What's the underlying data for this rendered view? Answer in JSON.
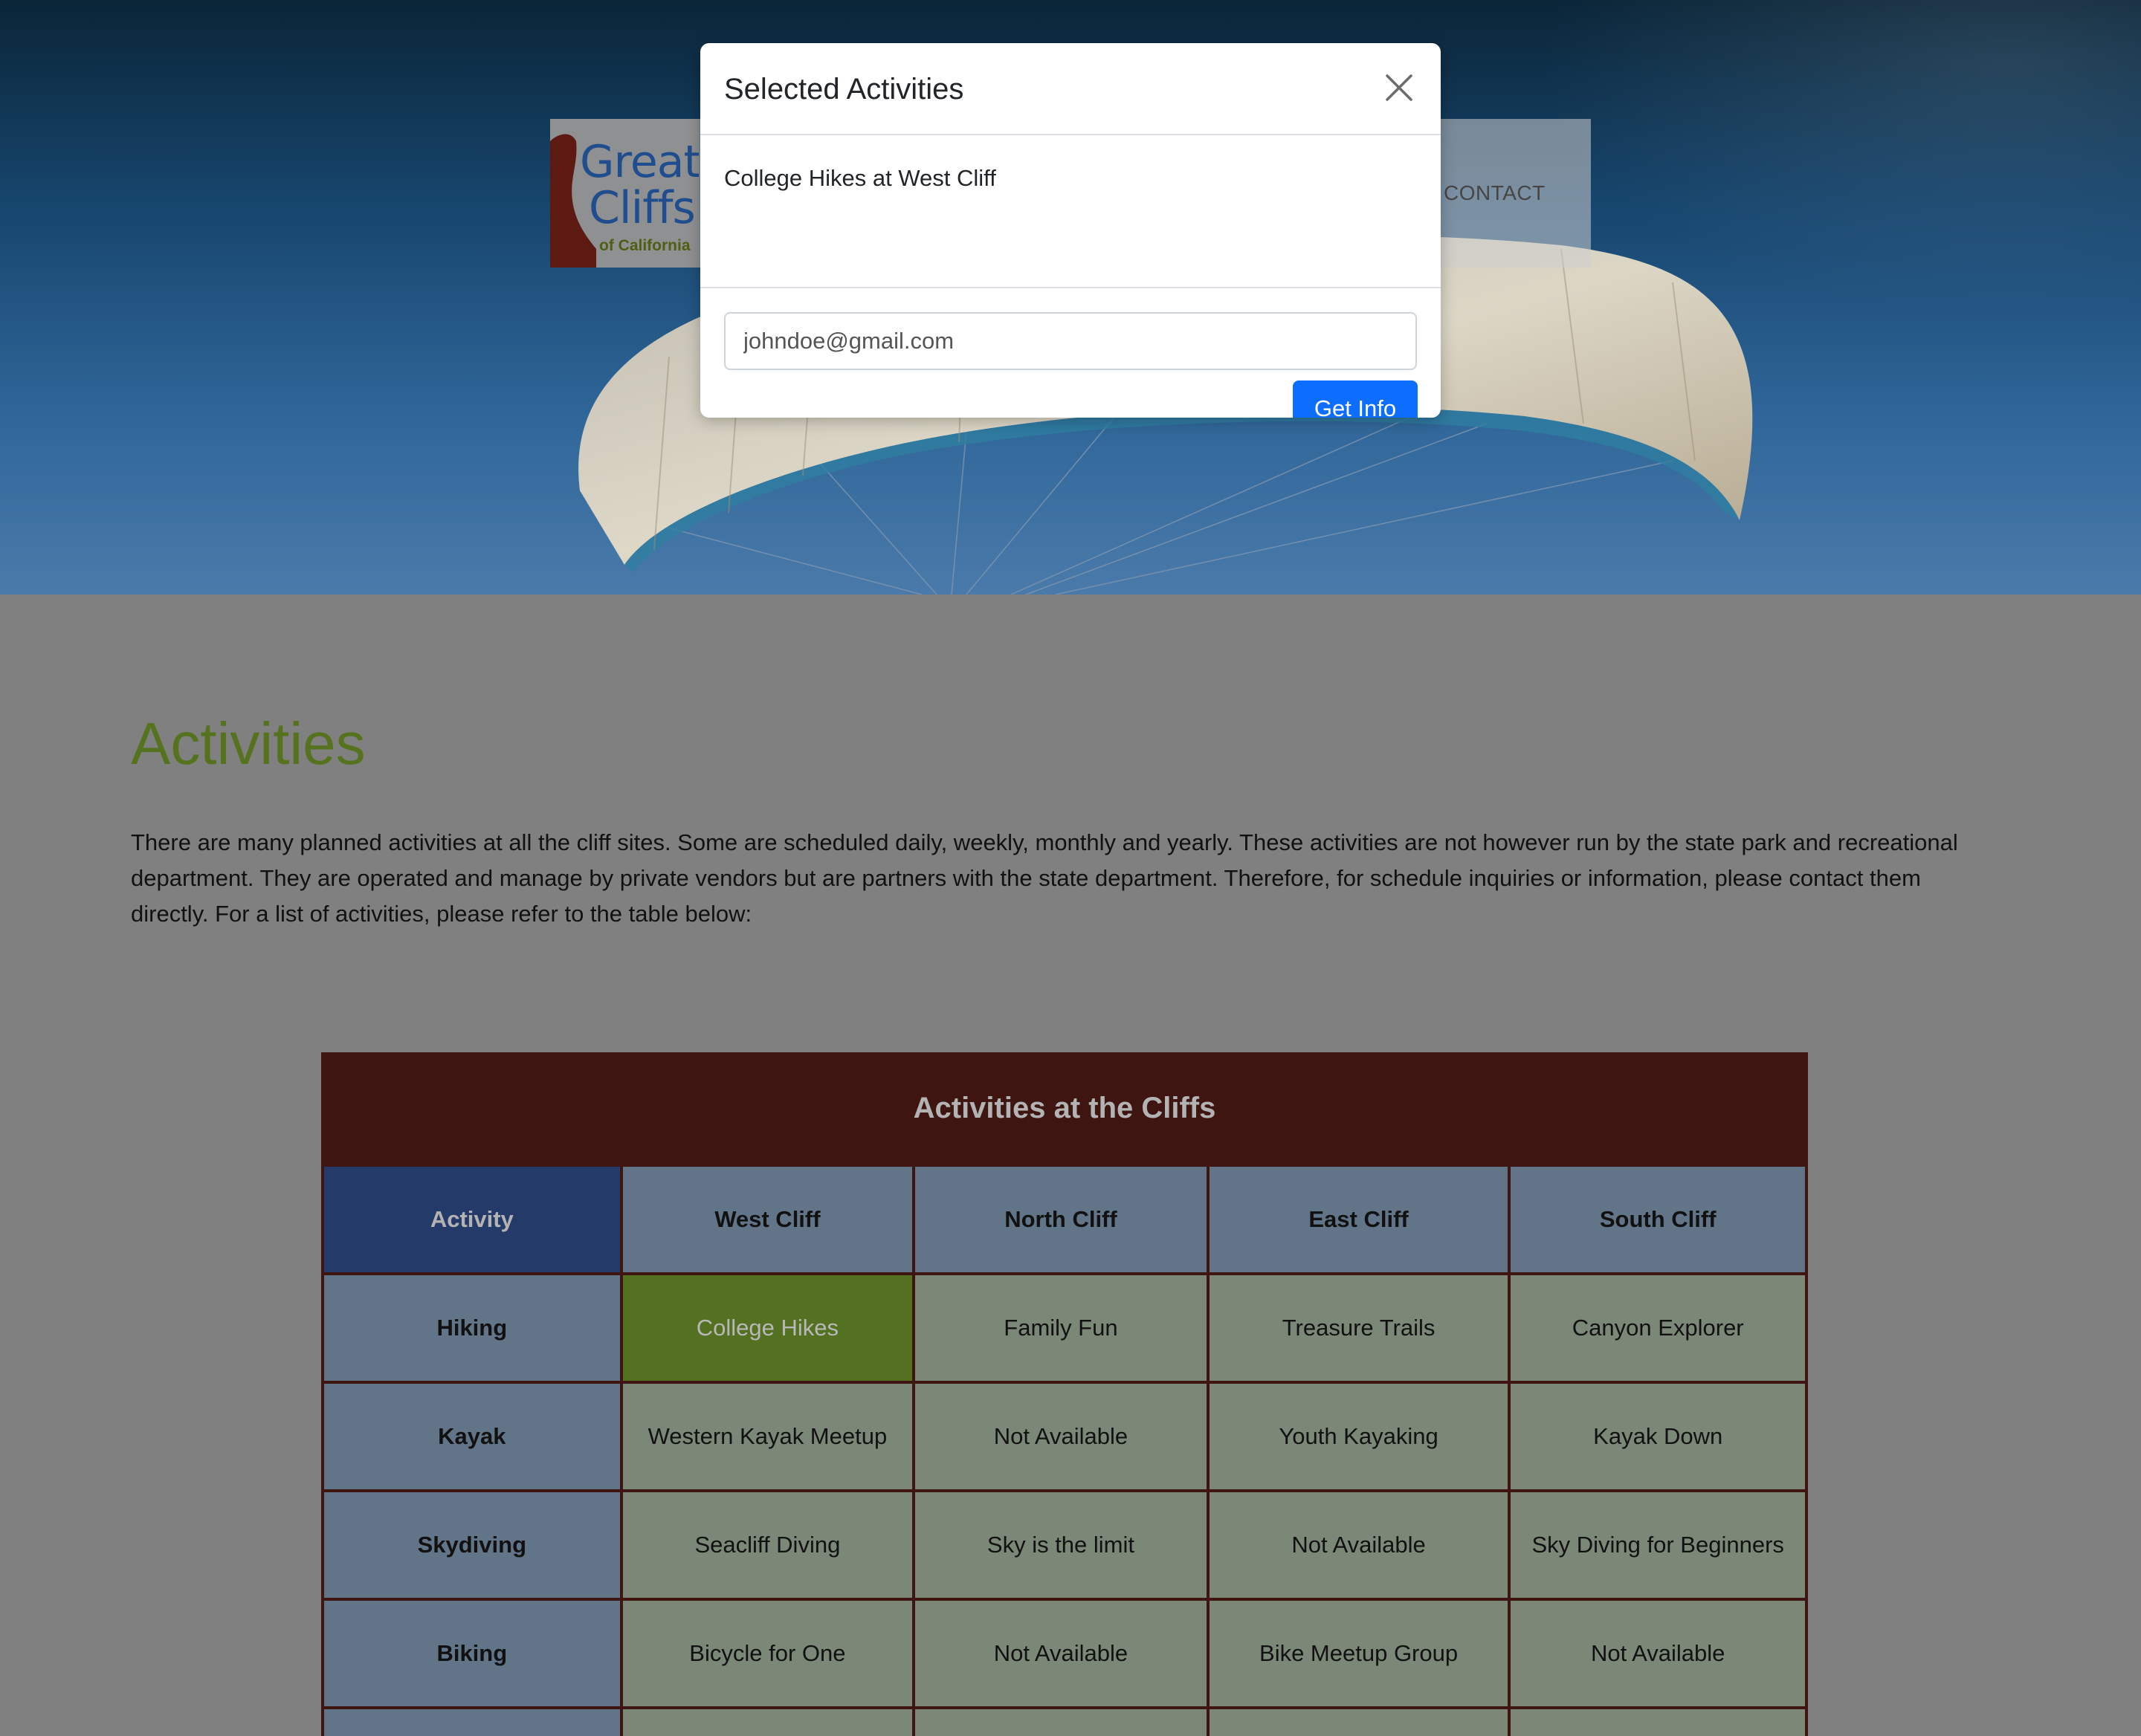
{
  "site": {
    "logo": {
      "line1": "Great",
      "line2": "Cliffs",
      "line3": "of California"
    },
    "nav": {
      "contact": "CONTACT"
    }
  },
  "page": {
    "title": "Activities",
    "intro": "There are many planned activities at all the cliff sites. Some are scheduled daily, weekly, monthly and yearly. These activities are not however run by the state park and recreational department. They are operated and manage by private vendors but are partners with the state department. Therefore, for schedule inquiries or information, please contact them directly. For a list of activities, please refer to the table below:"
  },
  "table": {
    "caption": "Activities at the Cliffs",
    "headers": [
      "Activity",
      "West Cliff",
      "North Cliff",
      "East Cliff",
      "South Cliff"
    ],
    "rows": [
      {
        "activity": "Hiking",
        "cells": [
          "College Hikes",
          "Family Fun",
          "Treasure Trails",
          "Canyon Explorer"
        ]
      },
      {
        "activity": "Kayak",
        "cells": [
          "Western Kayak Meetup",
          "Not Available",
          "Youth Kayaking",
          "Kayak Down"
        ]
      },
      {
        "activity": "Skydiving",
        "cells": [
          "Seacliff Diving",
          "Sky is the limit",
          "Not Available",
          "Sky Diving for Beginners"
        ]
      },
      {
        "activity": "Biking",
        "cells": [
          "Bicycle for One",
          "Not Available",
          "Bike Meetup Group",
          "Not Available"
        ]
      }
    ]
  },
  "modal": {
    "title": "Selected Activities",
    "selected_item": "College Hikes at West Cliff",
    "email_placeholder": "johndoe@gmail.com",
    "submit_label": "Get Info"
  },
  "colors": {
    "title_green": "#55731e",
    "table_border": "#3e1511",
    "header_blue": "#627588",
    "corner_blue": "#243a69",
    "cell_green": "#7b8777",
    "selected_green": "#537120",
    "primary_button": "#0d6efd"
  }
}
